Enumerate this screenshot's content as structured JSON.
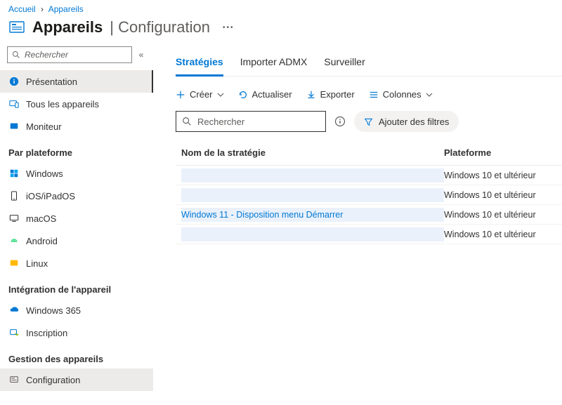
{
  "breadcrumb": {
    "home": "Accueil",
    "current": "Appareils"
  },
  "title": {
    "main": "Appareils",
    "sub": "Configuration",
    "sep": " | "
  },
  "sidebar": {
    "search_placeholder": "Rechercher",
    "items_top": [
      {
        "label": "Présentation"
      },
      {
        "label": "Tous les appareils"
      },
      {
        "label": "Moniteur"
      }
    ],
    "section_platform": "Par plateforme",
    "items_platform": [
      {
        "label": "Windows"
      },
      {
        "label": "iOS/iPadOS"
      },
      {
        "label": "macOS"
      },
      {
        "label": "Android"
      },
      {
        "label": "Linux"
      }
    ],
    "section_integration": "Intégration de l'appareil",
    "items_integration": [
      {
        "label": "Windows 365"
      },
      {
        "label": "Inscription"
      }
    ],
    "section_management": "Gestion des appareils",
    "items_management": [
      {
        "label": "Configuration"
      }
    ]
  },
  "tabs": [
    {
      "label": "Stratégies",
      "active": true
    },
    {
      "label": "Importer ADMX"
    },
    {
      "label": "Surveiller"
    }
  ],
  "toolbar": {
    "create": "Créer",
    "refresh": "Actualiser",
    "export": "Exporter",
    "columns": "Colonnes"
  },
  "filter": {
    "search_placeholder": "Rechercher",
    "add_filters": "Ajouter des filtres"
  },
  "grid": {
    "col_name": "Nom de la stratégie",
    "col_platform": "Plateforme",
    "rows": [
      {
        "name": "",
        "platform": "Windows 10 et ultérieur"
      },
      {
        "name": "",
        "platform": "Windows 10 et ultérieur"
      },
      {
        "name": "Windows 11 - Disposition menu Démarrer",
        "platform": "Windows 10 et ultérieur"
      },
      {
        "name": "",
        "platform": "Windows 10 et ultérieur"
      }
    ]
  }
}
